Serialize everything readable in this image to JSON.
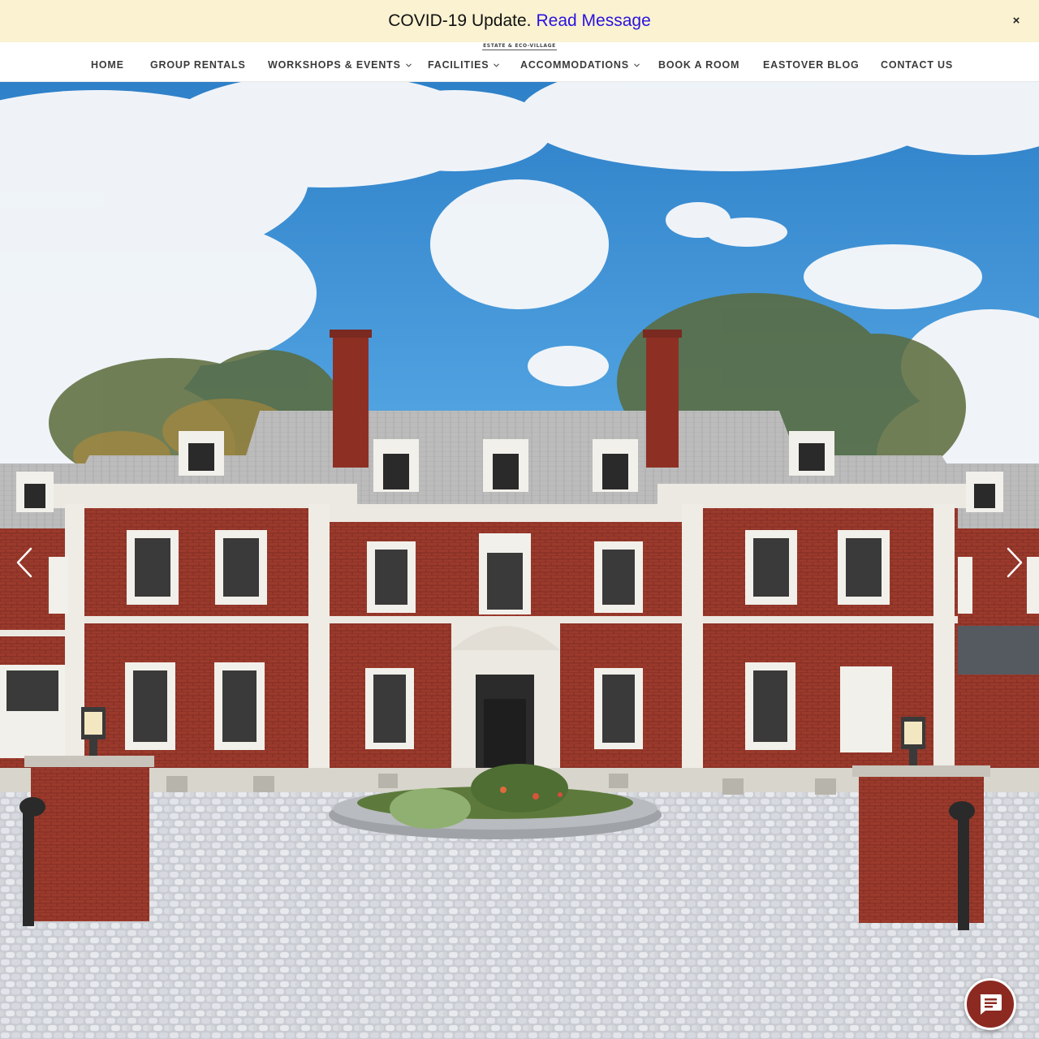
{
  "banner": {
    "text": "COVID-19 Update.",
    "link_label": "Read Message",
    "close_label": "×",
    "background": "#faf2d0",
    "link_color": "#2a12e0"
  },
  "header": {
    "tagline": "ESTATE & ECO-VILLAGE"
  },
  "nav": {
    "items": [
      {
        "label": "HOME",
        "dropdown": false
      },
      {
        "label": "GROUP RENTALS",
        "dropdown": false
      },
      {
        "label": "WORKSHOPS & EVENTS",
        "dropdown": true
      },
      {
        "label": "FACILITIES",
        "dropdown": true
      },
      {
        "label": "ACCOMMODATIONS",
        "dropdown": true
      },
      {
        "label": "BOOK A ROOM",
        "dropdown": false
      },
      {
        "label": "EASTOVER BLOG",
        "dropdown": false
      },
      {
        "label": "CONTACT US",
        "dropdown": false
      }
    ]
  },
  "hero": {
    "prev_icon": "chevron-left-icon",
    "next_icon": "chevron-right-icon"
  },
  "chat": {
    "icon": "chat-bubble-icon",
    "color": "#8c2a22"
  }
}
